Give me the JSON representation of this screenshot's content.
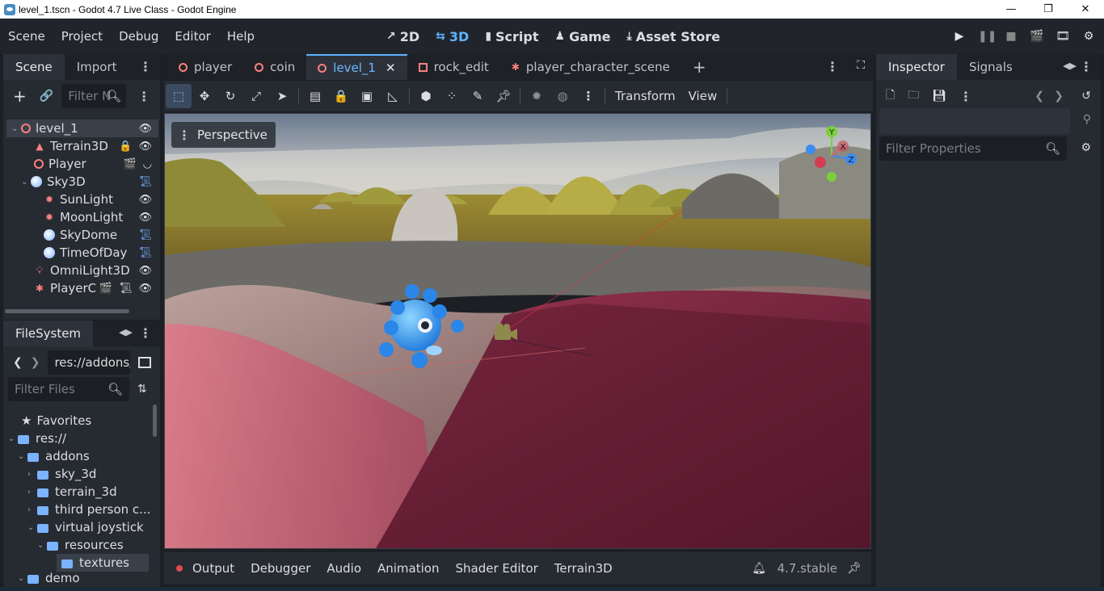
{
  "window": {
    "title": "level_1.tscn - Godot 4.7 Live Class - Godot Engine",
    "minimize": "—",
    "restore": "❐",
    "close": "✕"
  },
  "menu": {
    "items": [
      "Scene",
      "Project",
      "Debug",
      "Editor",
      "Help"
    ]
  },
  "workspaces": [
    {
      "label": "2D",
      "icon": "↗"
    },
    {
      "label": "3D",
      "icon": "⇆"
    },
    {
      "label": "Script",
      "icon": "▮"
    },
    {
      "label": "Game",
      "icon": "♟"
    },
    {
      "label": "Asset Store",
      "icon": "⤓"
    }
  ],
  "scene_dock": {
    "tabs": [
      "Scene",
      "Import"
    ],
    "filter_placeholder": "Filter N",
    "tree": [
      {
        "label": "level_1",
        "icon_color": "#fc7f7f"
      },
      {
        "label": "Terrain3D",
        "icon_color": "#fc7f7f"
      },
      {
        "label": "Player",
        "icon_color": "#fc7f7f"
      },
      {
        "label": "Sky3D",
        "icon_color": "#7ab3ff"
      },
      {
        "label": "SunLight",
        "icon_color": "#fc7f7f"
      },
      {
        "label": "MoonLight",
        "icon_color": "#fc7f7f"
      },
      {
        "label": "SkyDome",
        "icon_color": "#7ab3ff"
      },
      {
        "label": "TimeOfDay",
        "icon_color": "#7ab3ff"
      },
      {
        "label": "OmniLight3D",
        "icon_color": "#fc7f7f"
      },
      {
        "label": "PlayerC",
        "icon_color": "#fc7f7f"
      }
    ]
  },
  "filesystem": {
    "tab": "FileSystem",
    "path": "res://addons/",
    "filter_placeholder": "Filter Files",
    "favorites": "Favorites",
    "items": [
      "res://",
      "addons",
      "sky_3d",
      "terrain_3d",
      "third person c...",
      "virtual joystick",
      "resources",
      "textures",
      "demo"
    ]
  },
  "scene_tabs": [
    {
      "label": "player"
    },
    {
      "label": "coin"
    },
    {
      "label": "level_1"
    },
    {
      "label": "rock_edit"
    },
    {
      "label": "player_character_scene"
    }
  ],
  "viewport": {
    "menu_label": "Perspective",
    "toolbar_transform": "Transform",
    "toolbar_view": "View",
    "gizmo": {
      "y": "Y",
      "x": "X",
      "z": "Z"
    }
  },
  "bottom_panel": {
    "tabs": [
      "Output",
      "Debugger",
      "Audio",
      "Animation",
      "Shader Editor",
      "Terrain3D"
    ],
    "version": "4.7.stable"
  },
  "inspector": {
    "tabs": [
      "Inspector",
      "Signals"
    ],
    "filter_placeholder": "Filter Properties"
  }
}
